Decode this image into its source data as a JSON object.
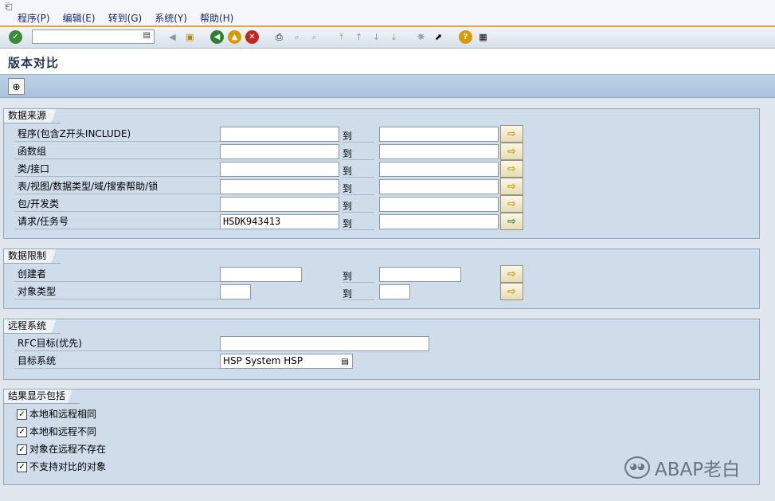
{
  "menu": [
    "程序(P)",
    "编辑(E)",
    "转到(G)",
    "系统(Y)",
    "帮助(H)"
  ],
  "title": "版本对比",
  "groups": {
    "source": {
      "title": "数据来源",
      "to_label": "到",
      "rows": [
        {
          "label": "程序(包含Z开头INCLUDE)",
          "from": "",
          "to": ""
        },
        {
          "label": "函数组",
          "from": "",
          "to": ""
        },
        {
          "label": "类/接口",
          "from": "",
          "to": ""
        },
        {
          "label": "表/视图/数据类型/域/搜索帮助/锁",
          "from": "",
          "to": ""
        },
        {
          "label": "包/开发类",
          "from": "",
          "to": ""
        },
        {
          "label": "请求/任务号",
          "from": "HSDK943413",
          "to": ""
        }
      ]
    },
    "limits": {
      "title": "数据限制",
      "to_label": "到",
      "rows": [
        {
          "label": "创建者",
          "from": "",
          "to": ""
        },
        {
          "label": "对象类型",
          "from": "",
          "to": ""
        }
      ]
    },
    "remote": {
      "title": "远程系统",
      "rfc_label": "RFC目标(优先)",
      "rfc_value": "",
      "target_label": "目标系统",
      "target_value": "HSP System HSP"
    },
    "results": {
      "title": "结果显示包括",
      "options": [
        {
          "label": "本地和远程相同",
          "checked": true
        },
        {
          "label": "本地和远程不同",
          "checked": true
        },
        {
          "label": "对象在远程不存在",
          "checked": true
        },
        {
          "label": "不支持对比的对象",
          "checked": true
        }
      ]
    }
  },
  "watermark": "ABAP老白",
  "icons": {
    "check": "check-icon",
    "save": "save-icon",
    "back": "back-icon",
    "exit": "exit-icon",
    "cancel": "cancel-icon",
    "print": "print-icon",
    "find": "find-icon",
    "help": "help-icon",
    "execute": "execute-icon"
  }
}
